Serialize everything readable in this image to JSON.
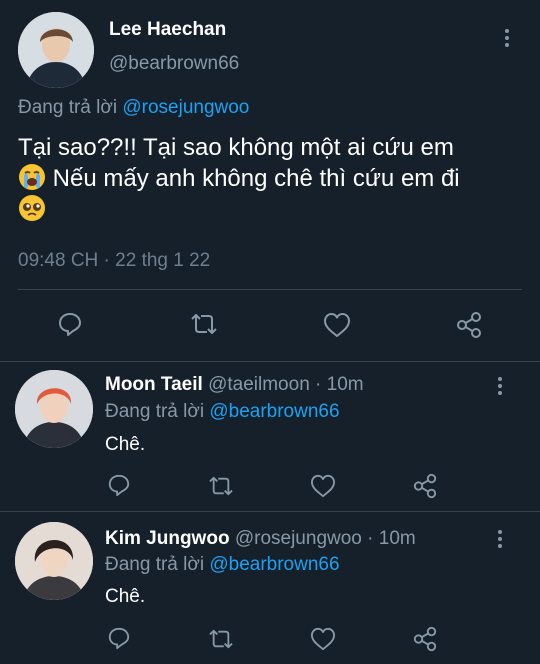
{
  "main_tweet": {
    "display_name": "Lee Haechan",
    "handle": "@bearbrown66",
    "replying_prefix": "Đang trả lời ",
    "replying_to": "@rosejungwoo",
    "text_line1": "Tại sao??!! Tại sao không một ai cứu em",
    "text_line2": " Nếu mấy anh không chê thì cứu em đi",
    "emoji_1": "loudly-crying-face",
    "emoji_2": "pleading-face",
    "timestamp": "09:48 CH · 22 thg 1 22",
    "actions": [
      "reply-icon",
      "retweet-icon",
      "like-icon",
      "share-icon"
    ]
  },
  "replies": [
    {
      "display_name": "Moon Taeil",
      "meta": " @taeilmoon · 10m",
      "replying_prefix": "Đang trả lời ",
      "replying_to": "@bearbrown66",
      "text": "Chê."
    },
    {
      "display_name": "Kim Jungwoo",
      "meta": " @rosejungwoo · 10m",
      "replying_prefix": "Đang trả lời ",
      "replying_to": "@bearbrown66",
      "text": "Chê."
    }
  ],
  "colors": {
    "background": "#15202b",
    "secondary_text": "#8899a6",
    "accent": "#1da1f2",
    "divider": "#38444d"
  }
}
